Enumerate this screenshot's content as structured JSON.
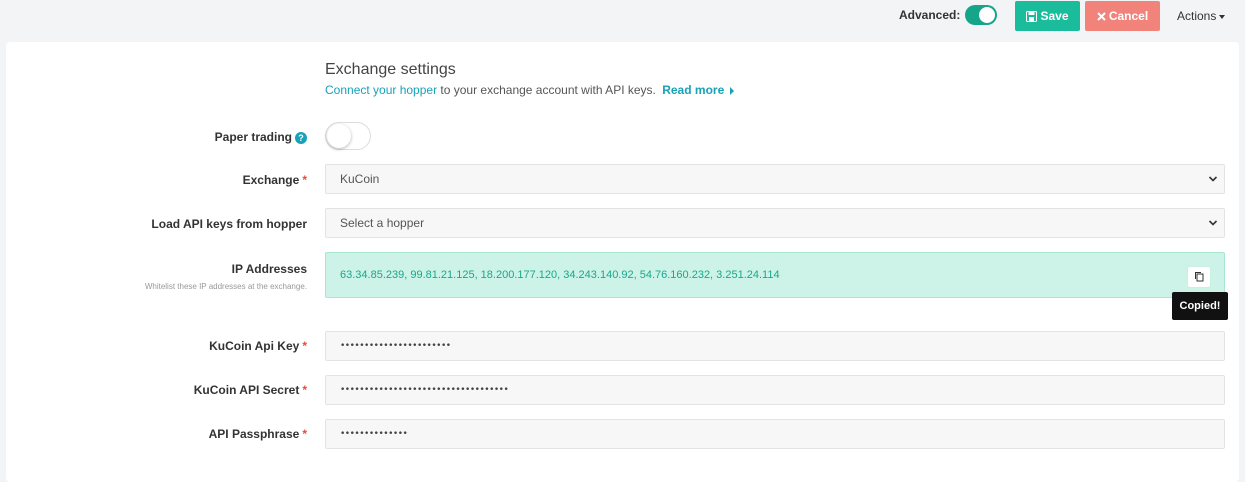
{
  "topbar": {
    "advanced_label": "Advanced:",
    "advanced_on": true,
    "save_label": "Save",
    "cancel_label": "Cancel",
    "actions_label": "Actions"
  },
  "section": {
    "title": "Exchange settings",
    "subtitle_link": "Connect your hopper",
    "subtitle_rest": " to your exchange account with API keys.",
    "read_more": "Read more"
  },
  "fields": {
    "paper_trading": {
      "label": "Paper trading",
      "on": false
    },
    "exchange": {
      "label": "Exchange",
      "value": "KuCoin"
    },
    "load_keys": {
      "label": "Load API keys from hopper",
      "value": "Select a hopper"
    },
    "ip": {
      "label": "IP Addresses",
      "sublabel": "Whitelist these IP addresses at the exchange.",
      "value": "63.34.85.239, 99.81.21.125, 18.200.177.120, 34.243.140.92, 54.76.160.232, 3.251.24.114",
      "tooltip": "Copied!"
    },
    "api_key": {
      "label": "KuCoin Api Key",
      "value": "•••••••••••••••••••••••"
    },
    "api_secret": {
      "label": "KuCoin API Secret",
      "value": "•••••••••••••••••••••••••••••••••••"
    },
    "passphrase": {
      "label": "API Passphrase",
      "value": "••••••••••••••"
    }
  },
  "colors": {
    "accent": "#1abc9c",
    "cancel": "#f1837a",
    "link": "#17a2b8",
    "ip_bg": "#cdf3e8"
  }
}
